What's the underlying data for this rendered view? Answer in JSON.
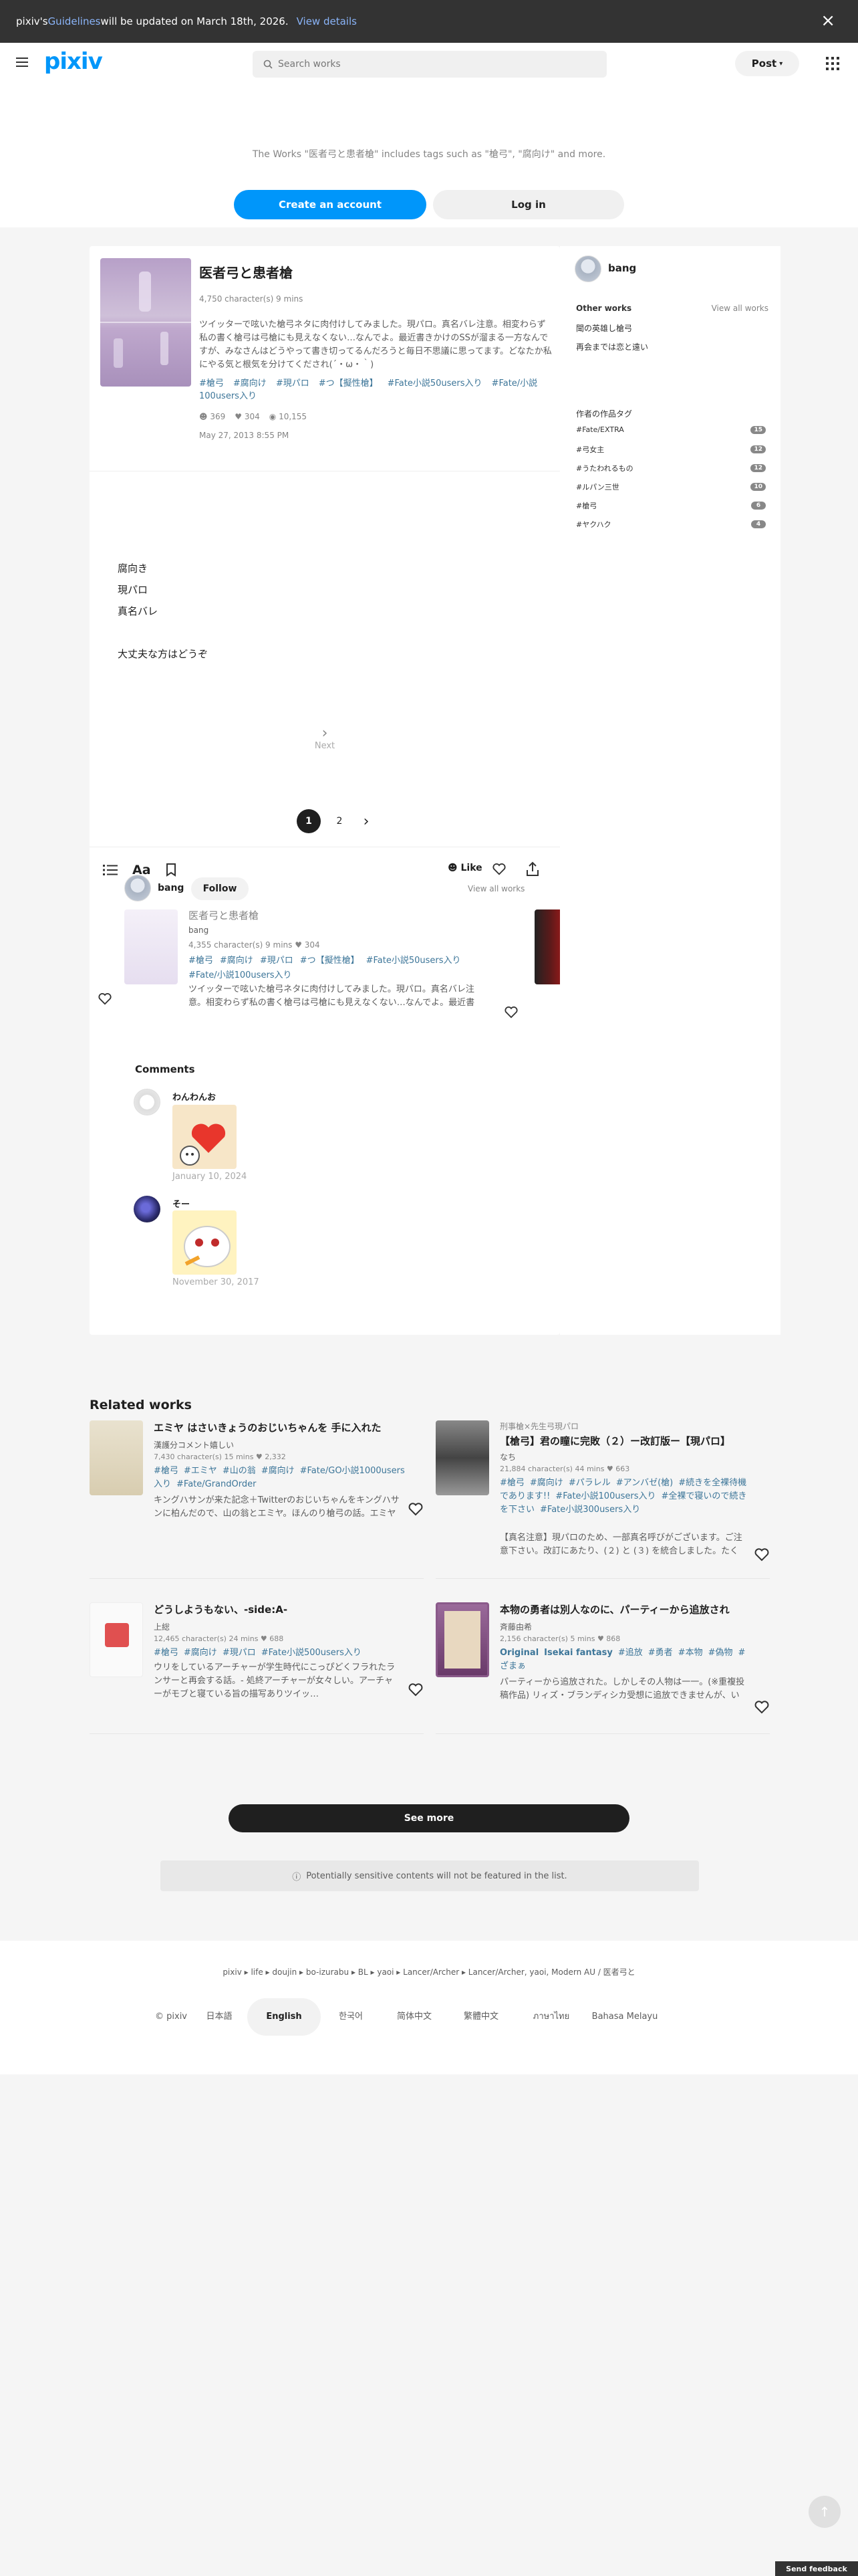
{
  "banner": {
    "prefix": "pixiv's ",
    "guidelines_link": "Guidelines",
    "suffix": " will be updated on March 18th, 2026.",
    "view_details": "View details",
    "close_icon": "×"
  },
  "header": {
    "logo": "pixiv",
    "search_placeholder": "Search works",
    "post_label": "Post"
  },
  "notice": {
    "text": "The Works \"医者弓と患者槍\" includes tags such as \"槍弓\", \"腐向け\" and more.",
    "create_account": "Create an account",
    "login": "Log in"
  },
  "work": {
    "title": "医者弓と患者槍",
    "meta": "4,750 character(s)   9 mins",
    "description": "ツイッターで呟いた槍弓ネタに肉付けしてみました。現パロ。真名バレ注意。相変わらず私の書く槍弓は弓槍にも見えなくない…なんでよ。最近書きかけのSSが溜まる一方なんですが、みなさんはどうやって書き切ってるんだろうと毎日不思議に思ってます。どなたか私にやる気と根気を分けてくだされ(´・ω・｀)",
    "tags": [
      "#槍弓",
      "#腐向け",
      "#現パロ",
      "#つ【擬性槍】",
      "#Fate小説50users入り",
      "#Fate/小説100users入り"
    ],
    "likes": "369",
    "bookmarks": "304",
    "views": "10,155",
    "date": "May 27, 2013 8:55 PM",
    "body_lines": [
      "腐向き",
      "現パロ",
      "真名バレ",
      "",
      "大丈夫な方はどうぞ"
    ],
    "next_label": "Next",
    "pages": [
      "1",
      "2"
    ],
    "like_label": "Like"
  },
  "author": {
    "name": "bang",
    "follow": "Follow",
    "view_all": "View all works"
  },
  "series_card": {
    "title": "医者弓と患者槍",
    "author": "bang",
    "meta": "4,355 character(s)   9 mins   ♥ 304",
    "tags": [
      "#槍弓",
      "#腐向け",
      "#現パロ",
      "#つ【擬性槍】",
      "#Fate小説50users入り",
      "#Fate/小説100users入り"
    ],
    "desc": "ツイッターで呟いた槍弓ネタに肉付けしてみました。現パロ。真名バレ注意。相変わらず私の書く槍弓は弓槍にも見えなくない…なんでよ。最近書きかけのSSが溜まる一方なんですが、みなさんはどうやって書き切って…"
  },
  "comments": {
    "heading": "Comments",
    "items": [
      {
        "user": "わんわんお",
        "date": "January 10, 2024"
      },
      {
        "user": "そー",
        "date": "November 30, 2017"
      }
    ]
  },
  "sidebar": {
    "user": "bang",
    "other_works": "Other works",
    "view_all": "View all works",
    "links": [
      "聞の英雄し槍弓",
      "再会までは恋と遠い"
    ],
    "tags_heading": "作者の作品タグ",
    "tags": [
      {
        "name": "#Fate/EXTRA",
        "count": "15"
      },
      {
        "name": "#弓女主",
        "count": "12"
      },
      {
        "name": "#うたわれるもの",
        "count": "12"
      },
      {
        "name": "#ルパン三世",
        "count": "10"
      },
      {
        "name": "#槍弓",
        "count": "6"
      },
      {
        "name": "#ヤクハク",
        "count": "4"
      }
    ]
  },
  "related": {
    "heading": "Related works",
    "items": [
      {
        "title": "エミヤ はさいきょうのおじいちゃんを 手に入れた",
        "sub": "",
        "author": "漢護分コメント嬉しい",
        "meta": "7,430 character(s)   15 mins   ♥ 2,332",
        "tags": [
          "#槍弓",
          "#エミヤ",
          "#山の翁",
          "#腐向け",
          "#Fate/GO小説1000users入り",
          "#Fate/GrandOrder"
        ],
        "desc": "キングハサンが来た記念＋Twitterのおじいちゃんをキングハサンに柏んだので、山の翁とエミヤ。ほんのり槍弓の話。エミヤにじいじを作って甘えさせてみたかった…"
      },
      {
        "title": "【槍弓】君の瞳に完敗（２）ー改訂版ー【現パロ】",
        "sub": "刑事槍×先生弓現パロ",
        "author": "なち",
        "meta": "21,884 character(s)   44 mins   ♥ 663",
        "tags": [
          "#槍弓",
          "#腐向け",
          "#パラレル",
          "#アンバゼ(槍)",
          "#続きを全裸待機であります!!",
          "#Fate小説100users入り",
          "#全裸で寝いので続きを下さい",
          "#Fate小説300users入り"
        ],
        "desc": "【真名注意】現パロのため、一部真名呼びがございます。ご注意下さい。改訂にあたり、(２) と (３) を統合しました。たくさんのブクマと評価、そして素敵タグ…"
      },
      {
        "title": "どうしようもない、-side:A-",
        "sub": "",
        "author": "上総",
        "meta": "12,465 character(s)   24 mins   ♥ 688",
        "tags": [
          "#槍弓",
          "#腐向け",
          "#現パロ",
          "#Fate小説500users入り"
        ],
        "desc": "ウリをしているアーチャーが学生時代にこっぴどくフラれたランサーと再会する話。- 処終アーチャーが女々しい。アーチャーがモブと寝ている旨の描写ありツイッ…"
      },
      {
        "title": "本物の勇者は別人なのに、パーティーから追放され",
        "sub": "",
        "author": "斉藤由希",
        "meta": "2,156 character(s)   5 mins   ♥ 868",
        "tags": [
          "Original",
          "Isekai fantasy",
          "#追放",
          "#勇者",
          "#本物",
          "#偽物",
          "#ざまぁ"
        ],
        "desc": "パーティーから追放された。しかしその人物は一一。(※重複投稿作品) リィズ・ブランディシカ受想に追放できませんが、いただいたものは全て読ませてもらって…"
      }
    ],
    "see_more": "See more",
    "sensitive": "Potentially sensitive contents will not be featured in the list."
  },
  "footer": {
    "breadcrumb": "pixiv  ▸  life  ▸  doujin  ▸  bo-izurabu  ▸  BL  ▸  yaoi  ▸  Lancer/Archer  ▸  Lancer/Archer, yaoi, Modern AU / 医者弓と",
    "copyright": "© pixiv",
    "languages": [
      "日本語",
      "English",
      "한국어",
      "简体中文",
      "繁體中文",
      "ภาษาไทย",
      "Bahasa Melayu"
    ]
  },
  "feedback": "Send feedback"
}
